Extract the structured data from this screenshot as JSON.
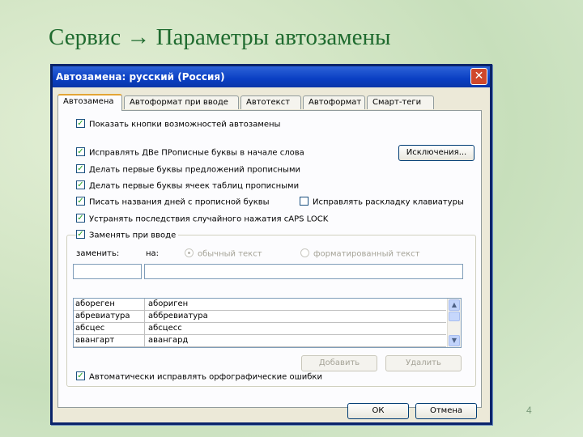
{
  "slide": {
    "title": "Сервис → Параметры автозамены",
    "page_number": "4"
  },
  "dialog": {
    "title": "Автозамена: русский (Россия)",
    "close_glyph": "✕",
    "tabs": [
      "Автозамена",
      "Автоформат при вводе",
      "Автотекст",
      "Автоформат",
      "Смарт-теги"
    ],
    "active_tab": 0,
    "options": {
      "show_buttons": "Показать кнопки возможностей автозамены",
      "two_capitals": "Исправлять ДВе ПРописные буквы в начале слова",
      "capitalize_sentences": "Делать первые буквы предложений прописными",
      "capitalize_table_cells": "Делать первые буквы ячеек таблиц прописными",
      "capitalize_days": "Писать названия дней с прописной буквы",
      "fix_keyboard_layout": "Исправлять раскладку клавиатуры",
      "caps_lock": "Устранять последствия случайного нажатия cAPS LOCK",
      "replace_as_you_type": "Заменять при вводе",
      "auto_spelling": "Автоматически исправлять орфографические ошибки"
    },
    "checked": {
      "show_buttons": true,
      "two_capitals": true,
      "capitalize_sentences": true,
      "capitalize_table_cells": true,
      "capitalize_days": true,
      "fix_keyboard_layout": false,
      "caps_lock": true,
      "replace_as_you_type": true,
      "auto_spelling": true
    },
    "exceptions_button": "Исключения...",
    "replace_label": "заменить:",
    "with_label": "на:",
    "radio_plain": "обычный текст",
    "radio_formatted": "форматированный текст",
    "replace_value": "",
    "with_value": "",
    "replacements": [
      [
        "абореген",
        "абориген"
      ],
      [
        "абревиатура",
        "аббревиатура"
      ],
      [
        "абсцес",
        "абсцесс"
      ],
      [
        "авангарт",
        "авангард"
      ]
    ],
    "add_button": "Добавить",
    "delete_button": "Удалить",
    "ok_button": "ОК",
    "cancel_button": "Отмена"
  },
  "colors": {
    "title_green": "#1f6b2f",
    "xp_blue": "#0a3fc3",
    "check_green": "#21a121"
  }
}
